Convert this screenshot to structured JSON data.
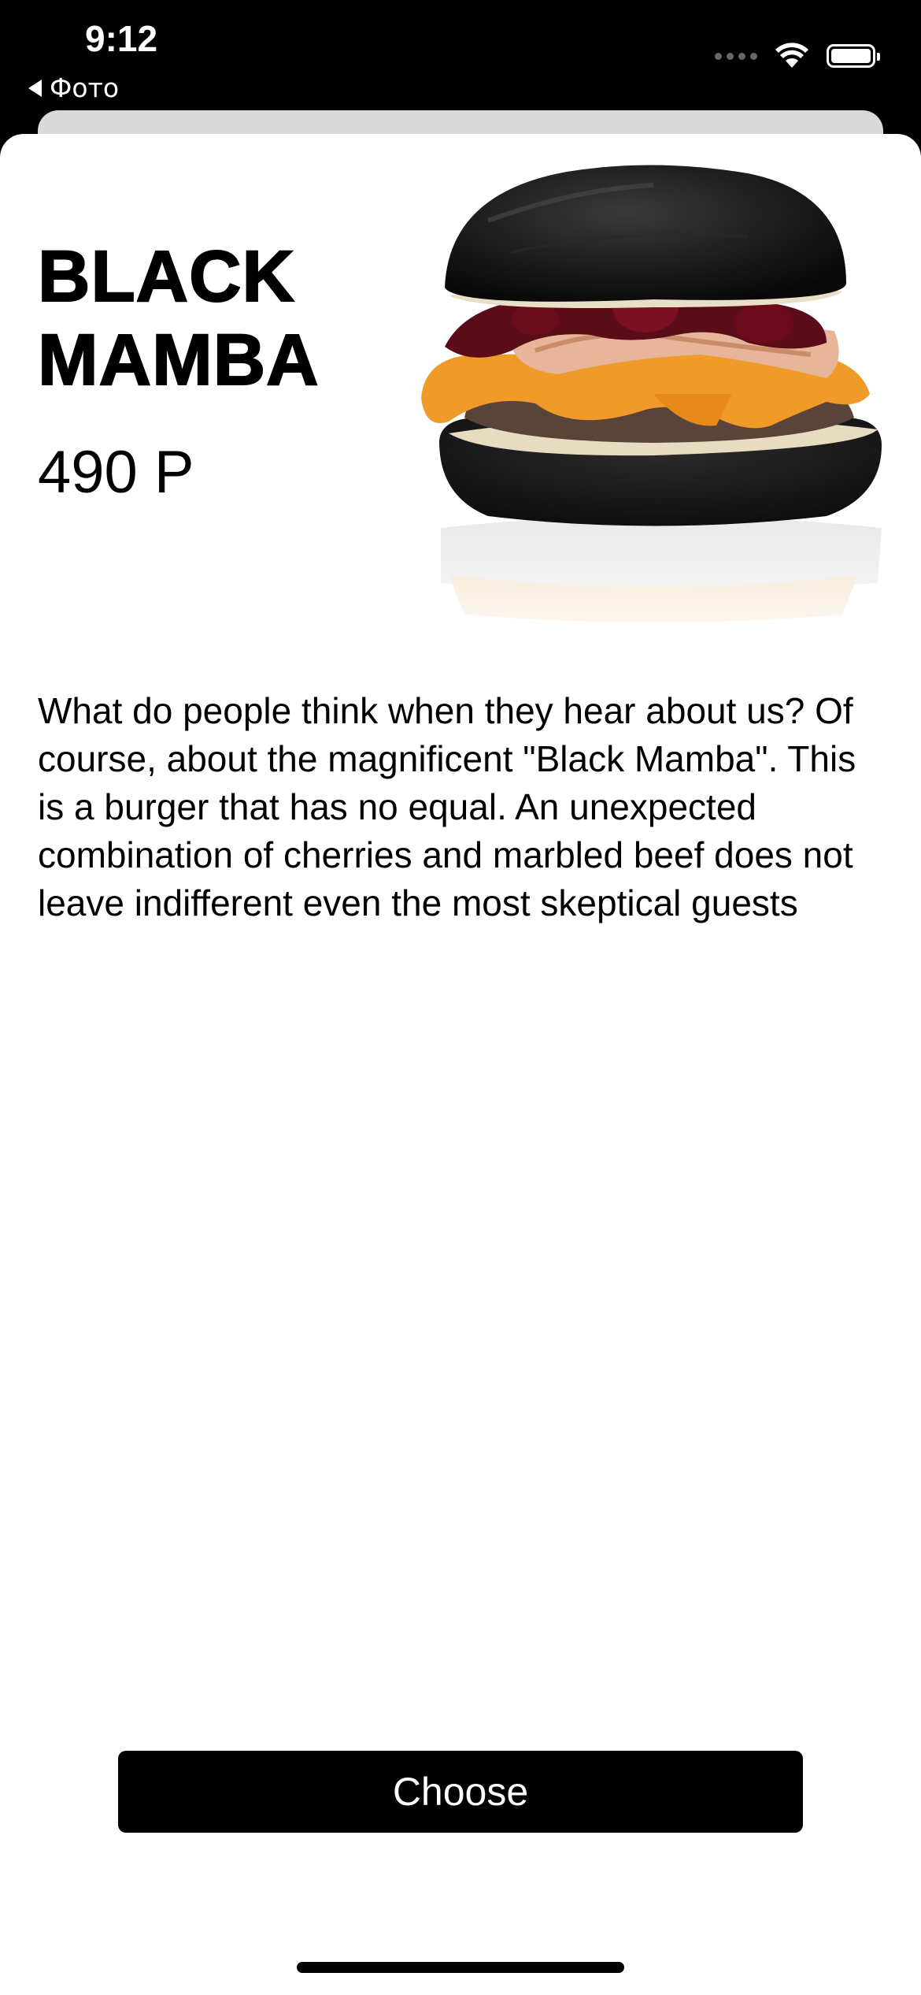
{
  "status_bar": {
    "time": "9:12",
    "back_app_label": "Фото"
  },
  "product": {
    "name_line1": "BLACK",
    "name_line2": "MAMBA",
    "price": "490 P",
    "description": "What do people think when they hear about us? Of course, about the magnificent \"Black Mamba\". This is a burger that has no equal. An unexpected combination of cherries and marbled beef does not leave indifferent even the most skeptical guests",
    "image_icon": "burger-photo"
  },
  "actions": {
    "choose_label": "Choose"
  },
  "colors": {
    "accent": "#000000",
    "sheet_background": "#ffffff",
    "button_text": "#ffffff"
  }
}
